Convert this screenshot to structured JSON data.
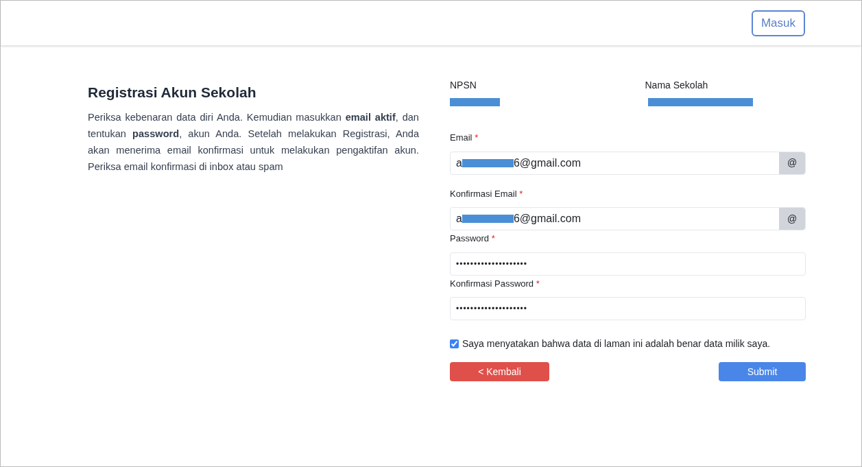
{
  "header": {
    "login_button": "Masuk"
  },
  "intro": {
    "title": "Registrasi Akun Sekolah",
    "text": "Periksa kebenaran data diri Anda. Kemudian masukkan **email aktif**, dan tentukan **password**, akun Anda. Setelah melakukan Registrasi, Anda akan menerima email konfirmasi untuk melakukan pengaktifan akun. Periksa email konfirmasi di inbox atau spam"
  },
  "school": [
    {
      "label": "NPSN",
      "redacted": true
    },
    {
      "label": "Nama Sekolah",
      "redacted": true
    }
  ],
  "fields": [
    {
      "label": "Email",
      "required": "*",
      "kind": "email",
      "value_start": "a",
      "value_end": "6@gmail.com",
      "redacted": true,
      "addon": "@"
    },
    {
      "label": "Konfirmasi Email",
      "required": "*",
      "kind": "email",
      "value_start": "a",
      "value_end": "6@gmail.com",
      "redacted": true,
      "addon": "@"
    },
    {
      "label": "Password",
      "required": "*",
      "kind": "password",
      "value": "••••••••••••••••••••"
    },
    {
      "label": "Konfirmasi Password",
      "required": "*",
      "kind": "password",
      "value": "••••••••••••••••••••"
    }
  ],
  "agreement": {
    "checked": true,
    "text": "Saya menyatakan bahwa data di laman ini adalah benar data milik saya."
  },
  "buttons": {
    "back": "< Kembali",
    "submit": "Submit"
  }
}
